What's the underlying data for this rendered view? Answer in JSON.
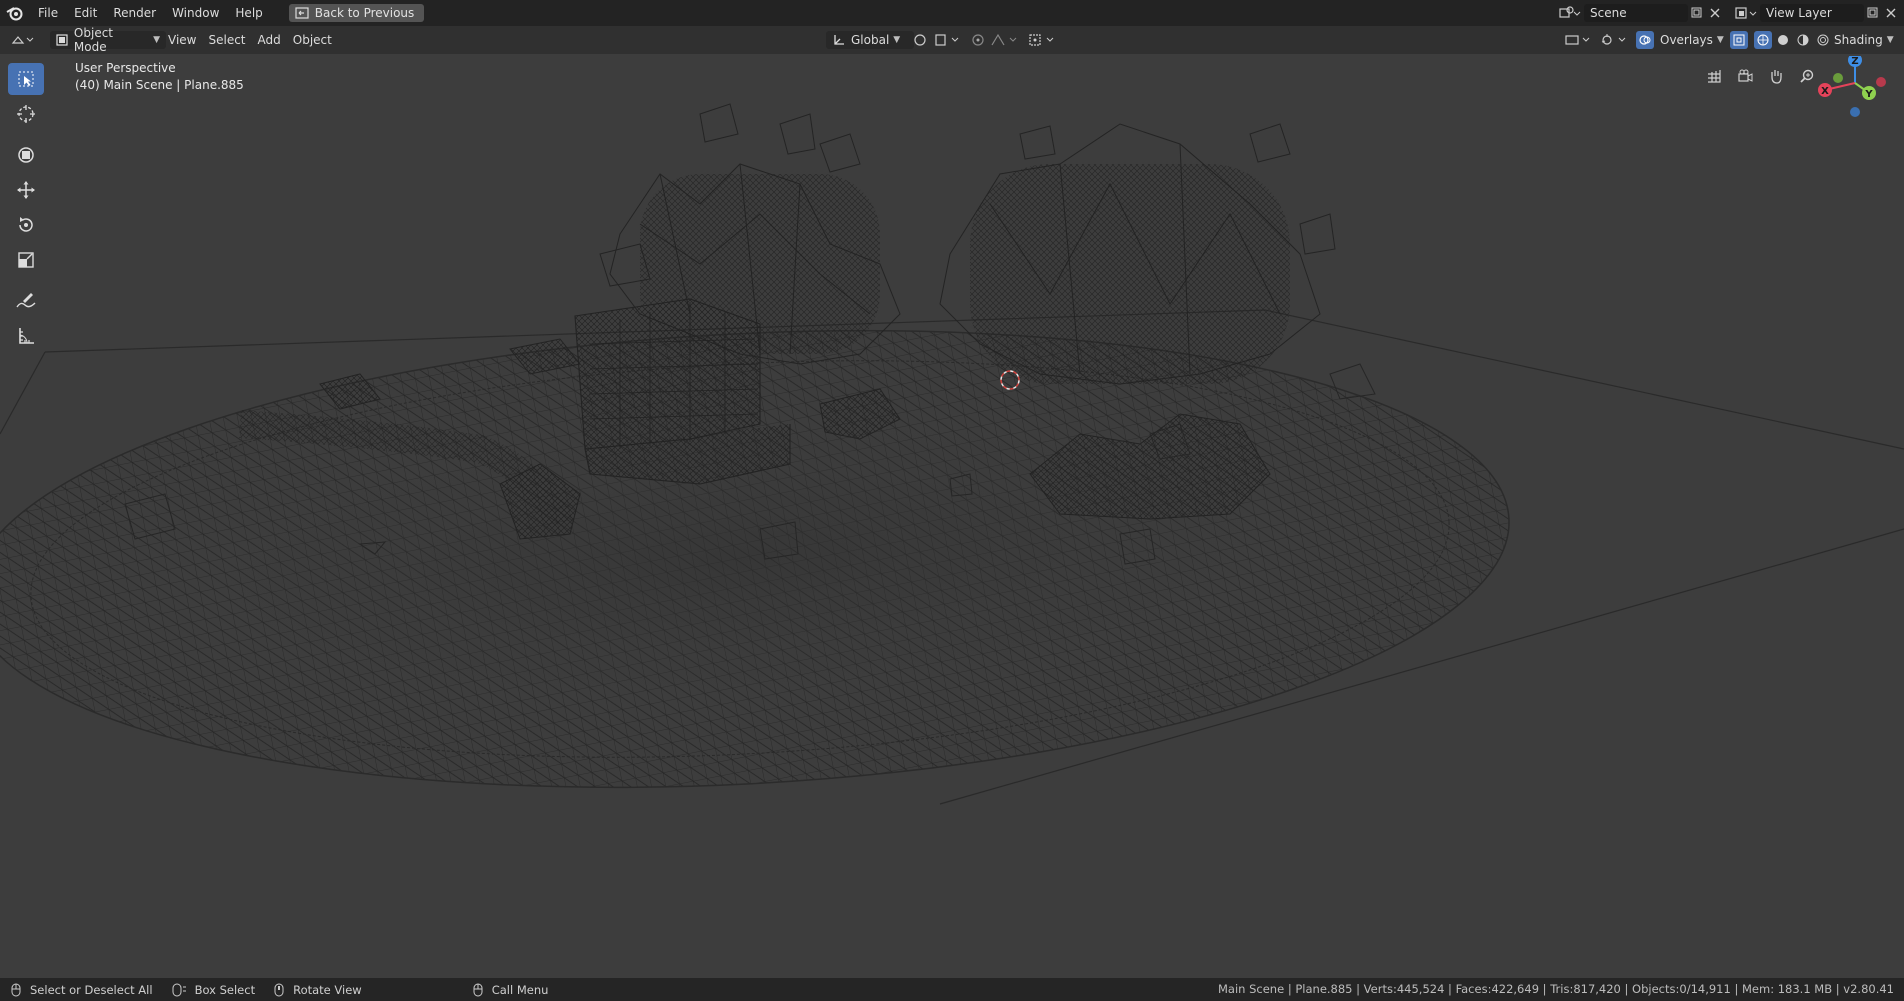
{
  "topbar": {
    "logo_icon": "blender-logo-icon",
    "menus": [
      "File",
      "Edit",
      "Render",
      "Window",
      "Help"
    ],
    "back_button": "Back to Previous",
    "scene_name": "Scene",
    "view_layer": "View Layer"
  },
  "header": {
    "mode": "Object Mode",
    "menus": [
      "View",
      "Select",
      "Add",
      "Object"
    ],
    "transform_orientation": "Global",
    "overlays": "Overlays",
    "shading": "Shading"
  },
  "viewport": {
    "perspective_label": "User Perspective",
    "object_label": "(40) Main Scene | Plane.885",
    "gizmo": {
      "x": "X",
      "y": "Y",
      "z": "Z"
    },
    "colors": {
      "x_axis": "#e5435a",
      "y_axis": "#8fd14f",
      "z_axis": "#3e8ee6",
      "background": "#3d3d3d"
    }
  },
  "tools": [
    "select-box-icon",
    "cursor-icon",
    "transform-icon",
    "move-icon",
    "rotate-icon",
    "scale-icon",
    "annotate-icon",
    "measure-icon"
  ],
  "statusbar": {
    "select": "Select or Deselect All",
    "box_select": "Box Select",
    "rotate": "Rotate View",
    "call_menu": "Call Menu",
    "stats": "Main Scene | Plane.885 | Verts:445,524 | Faces:422,649 | Tris:817,420 | Objects:0/14,911 | Mem: 183.1 MB | v2.80.41"
  },
  "accent": "#4772b3"
}
